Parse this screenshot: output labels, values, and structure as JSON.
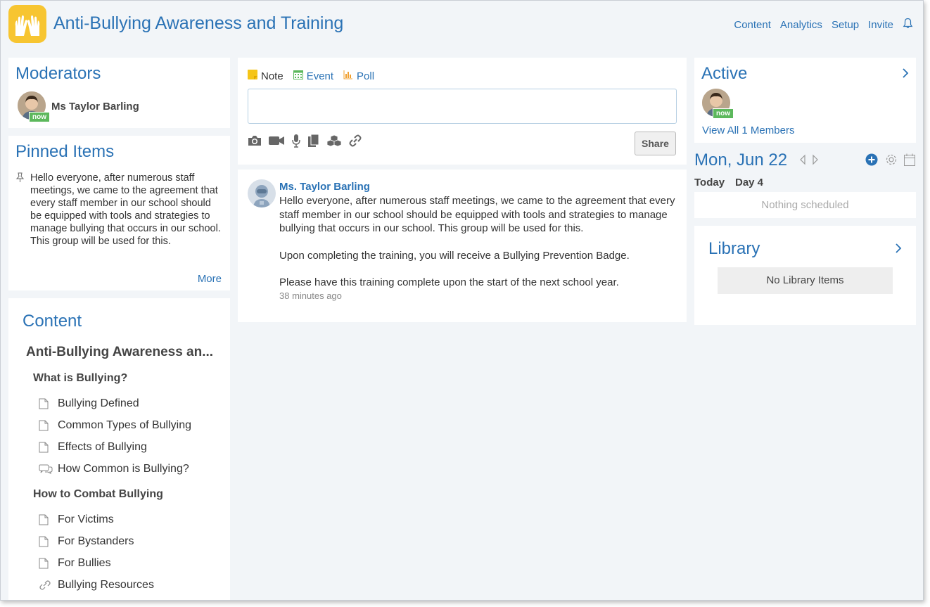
{
  "header": {
    "title": "Anti-Bullying Awareness and Training",
    "nav": [
      "Content",
      "Analytics",
      "Setup",
      "Invite"
    ]
  },
  "moderators": {
    "title": "Moderators",
    "name": "Ms Taylor Barling",
    "status": "now"
  },
  "pinned": {
    "title": "Pinned Items",
    "text": "Hello everyone, after numerous staff meetings, we came to the agreement that every staff member in our school should be equipped with tools and strategies to manage bullying that occurs in our school. This group will be used for this.",
    "more": "More"
  },
  "content": {
    "title": "Content",
    "folder": "Anti-Bullying Awareness an...",
    "sections": [
      {
        "heading": "What is Bullying?",
        "items": [
          {
            "label": "Bullying Defined",
            "icon": "page-icon"
          },
          {
            "label": "Common Types of Bullying",
            "icon": "page-icon"
          },
          {
            "label": "Effects of Bullying",
            "icon": "page-icon"
          },
          {
            "label": "How Common is Bullying?",
            "icon": "discussion-icon"
          }
        ]
      },
      {
        "heading": "How to Combat Bullying",
        "items": [
          {
            "label": "For Victims",
            "icon": "page-icon"
          },
          {
            "label": "For Bystanders",
            "icon": "page-icon"
          },
          {
            "label": "For Bullies",
            "icon": "page-icon"
          },
          {
            "label": "Bullying Resources",
            "icon": "link-icon"
          }
        ]
      }
    ]
  },
  "composer": {
    "tabs": [
      {
        "label": "Note",
        "color": "#333333",
        "icon": "note-icon",
        "icon_color": "#f5c518"
      },
      {
        "label": "Event",
        "color": "#2a72b5",
        "icon": "calendar-icon",
        "icon_color": "#5cb85c"
      },
      {
        "label": "Poll",
        "color": "#2a72b5",
        "icon": "poll-icon",
        "icon_color": "#f0a030"
      }
    ],
    "share": "Share"
  },
  "feed": {
    "author": "Ms. Taylor Barling",
    "paragraphs": [
      "Hello everyone, after numerous staff meetings, we came to the agreement that every staff member in our school should be equipped with tools and strategies to manage bullying that occurs in our school. This group will be used for this.",
      "Upon completing the training, you will receive a Bullying Prevention Badge.",
      "Please have this training complete upon the start of the next school year."
    ],
    "time": "38 minutes ago"
  },
  "active": {
    "title": "Active",
    "status": "now",
    "view_all": "View All 1 Members"
  },
  "calendar": {
    "date": "Mon, Jun 22",
    "today": "Today",
    "day": "Day 4",
    "empty": "Nothing scheduled"
  },
  "library": {
    "title": "Library",
    "empty": "No Library Items"
  },
  "colors": {
    "accent": "#2a72b5",
    "logo": "#f7c531",
    "badge": "#5cb85c",
    "page_bg": "#f2f5f8"
  }
}
